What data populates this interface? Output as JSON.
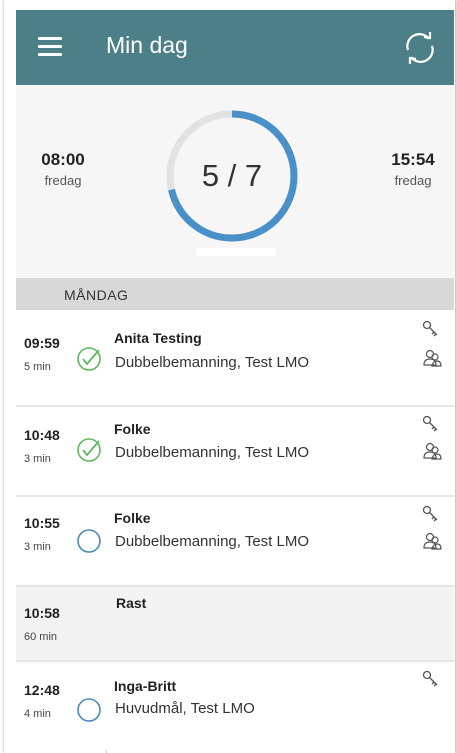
{
  "app": {
    "title": "Min dag",
    "menu_icon": "hamburger-menu-icon",
    "sync_icon": "sync-icon",
    "header_color": "#4d7f89"
  },
  "summary": {
    "start_time": "08:00",
    "start_day": "fredag",
    "end_time": "15:54",
    "end_day": "fredag",
    "progress_text": "5 / 7",
    "completed": 5,
    "total": 7,
    "progress_color": "#4a90c8"
  },
  "day_header": "MÅNDAG",
  "visits": [
    {
      "time": "09:59",
      "duration": "5 min",
      "name": "Anita Testing",
      "description": "Dubbelbemanning, Test LMO",
      "status": "done",
      "icons": [
        "key-icon",
        "double-staff-icon"
      ]
    },
    {
      "time": "10:48",
      "duration": "3 min",
      "name": "Folke",
      "description": "Dubbelbemanning, Test LMO",
      "status": "done",
      "icons": [
        "key-icon",
        "double-staff-icon"
      ]
    },
    {
      "time": "10:55",
      "duration": "3 min",
      "name": "Folke",
      "description": "Dubbelbemanning, Test LMO",
      "status": "pending",
      "icons": [
        "key-icon",
        "double-staff-icon"
      ]
    },
    {
      "time": "10:58",
      "duration": "60 min",
      "name": "Rast",
      "description": "",
      "status": "break",
      "icons": []
    },
    {
      "time": "12:48",
      "duration": "4 min",
      "name": "Inga-Britt",
      "description": "Huvudmål, Test LMO",
      "status": "pending",
      "icons": [
        "key-icon"
      ]
    }
  ],
  "colors": {
    "check": "#5cb85c",
    "pending_circle": "#4a8ab8"
  }
}
